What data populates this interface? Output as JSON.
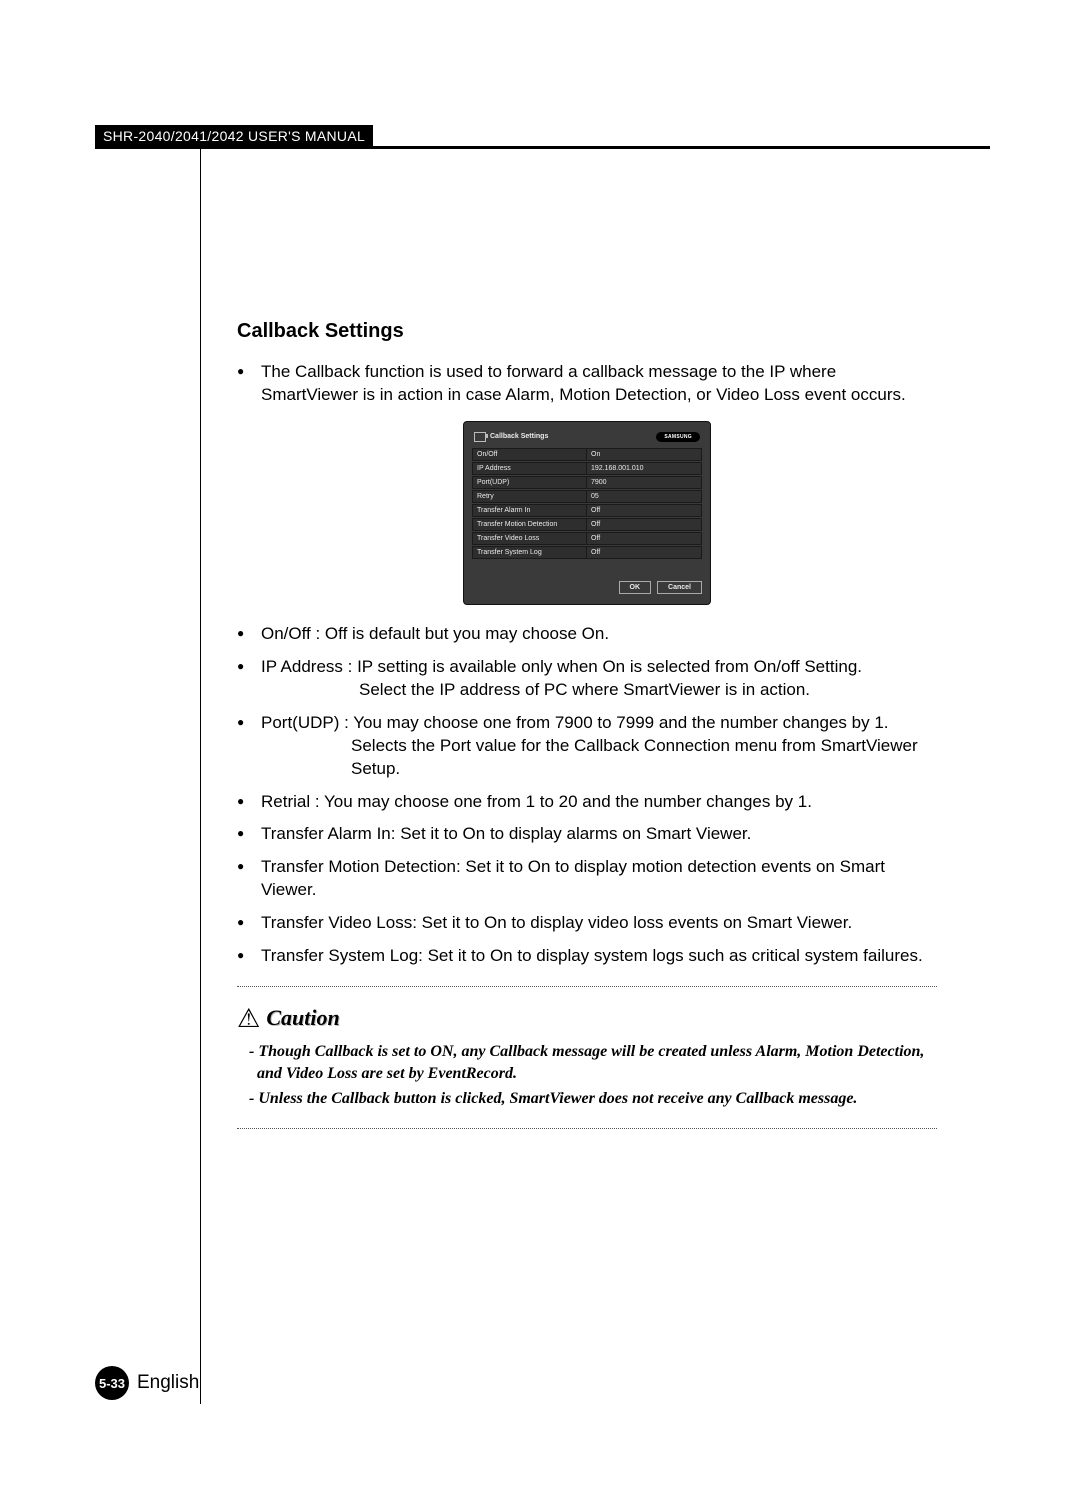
{
  "header": {
    "title": "SHR-2040/2041/2042 USER'S MANUAL"
  },
  "section": {
    "title": "Callback Settings"
  },
  "intro": "The Callback function is used to forward a callback message to the IP where SmartViewer is in action in case Alarm, Motion Detection, or Video Loss event occurs.",
  "panel": {
    "title": "Callback Settings",
    "brand": "SAMSUNG",
    "rows": [
      {
        "k": "On/Off",
        "v": "On"
      },
      {
        "k": "IP Address",
        "v": "192.168.001.010"
      },
      {
        "k": "Port(UDP)",
        "v": "7900"
      },
      {
        "k": "Retry",
        "v": "05"
      },
      {
        "k": "Transfer Alarm In",
        "v": "Off"
      },
      {
        "k": "Transfer Motion Detection",
        "v": "Off"
      },
      {
        "k": "Transfer Video Loss",
        "v": "Off"
      },
      {
        "k": "Transfer System Log",
        "v": "Off"
      }
    ],
    "ok": "OK",
    "cancel": "Cancel"
  },
  "bullets": {
    "b1": "On/Off : Off is default but you may choose On.",
    "b2": "IP Address : IP setting is available only when On is selected from On/off Setting.",
    "b2s": "Select the IP address of PC where SmartViewer is in action.",
    "b3": "Port(UDP) : You may choose one from 7900 to 7999 and the number changes by 1.",
    "b3s": "Selects the Port value for the Callback Connection menu from SmartViewer Setup.",
    "b4": "Retrial : You may choose one from 1 to 20 and the number changes by 1.",
    "b5": "Transfer Alarm In: Set it to On to display alarms on Smart Viewer.",
    "b6": "Transfer Motion Detection: Set it to On to display motion detection events on Smart Viewer.",
    "b7": "Transfer Video Loss: Set it to On to display video loss events on Smart Viewer.",
    "b8": "Transfer System Log: Set it to On to display system logs such as critical system failures."
  },
  "caution": {
    "word": "Caution",
    "c1": "- Though Callback is set to ON, any Callback message will be created unless Alarm, Motion Detection, and Video Loss are set by EventRecord.",
    "c2": "- Unless the Callback button is clicked, SmartViewer does not receive any Callback message."
  },
  "footer": {
    "page": "5-33",
    "lang": "English"
  }
}
